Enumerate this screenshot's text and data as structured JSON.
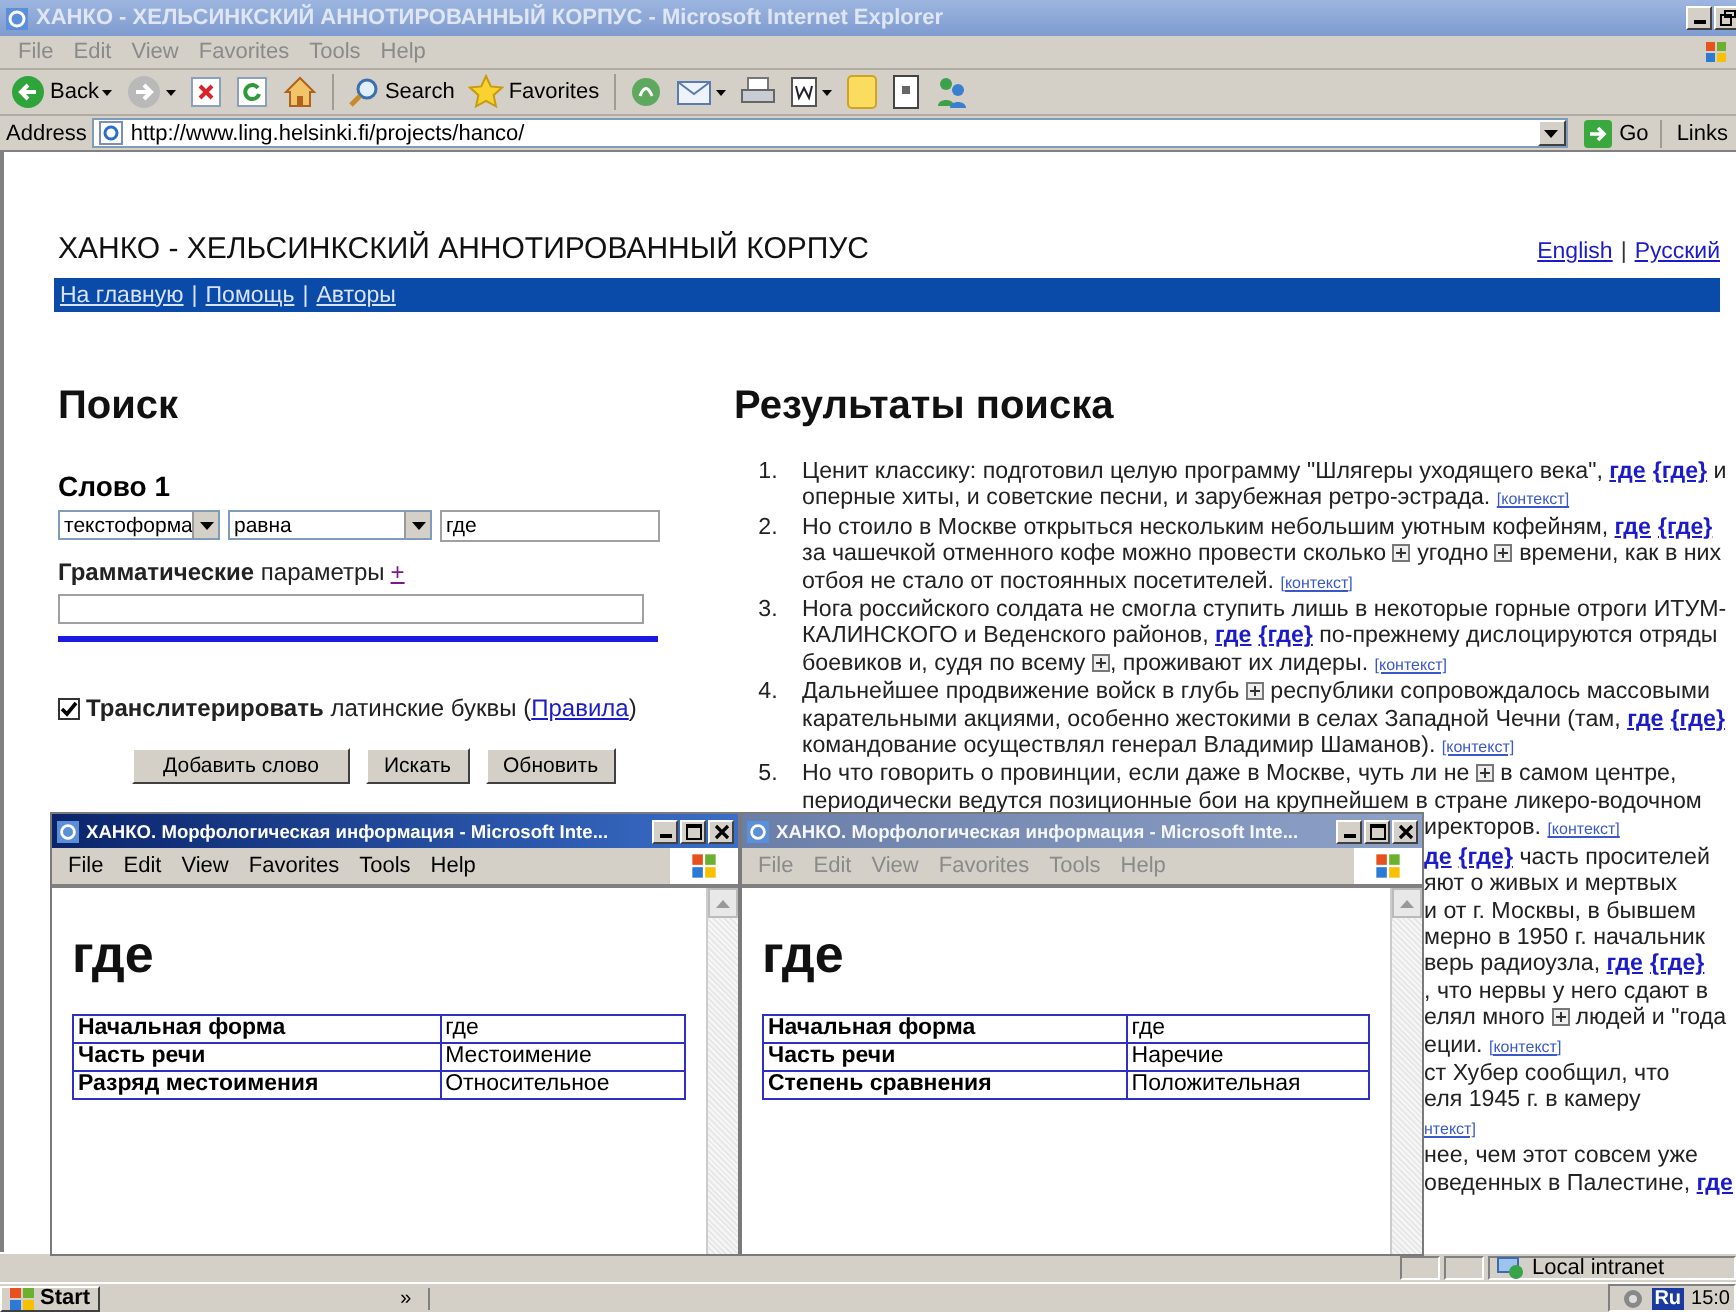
{
  "main_window": {
    "title": "ХАНКО - ХЕЛЬСИНКСКИЙ АННОТИРОВАННЫЙ КОРПУС - Microsoft Internet Explorer",
    "active": false,
    "menu": [
      "File",
      "Edit",
      "View",
      "Favorites",
      "Tools",
      "Help"
    ],
    "toolbar": [
      {
        "kind": "back",
        "label": "Back",
        "dropdown": true
      },
      {
        "kind": "forward",
        "dropdown": true
      },
      {
        "kind": "stop"
      },
      {
        "kind": "refresh"
      },
      {
        "kind": "home"
      },
      {
        "kind": "search",
        "label": "Search"
      },
      {
        "kind": "favorites",
        "label": "Favorites"
      },
      {
        "kind": "media"
      },
      {
        "kind": "mail",
        "dropdown": true
      },
      {
        "kind": "print"
      },
      {
        "kind": "word",
        "dropdown": true
      },
      {
        "kind": "folder"
      },
      {
        "kind": "notes"
      },
      {
        "kind": "messenger"
      }
    ],
    "address": {
      "label": "Address",
      "url": "http://www.ling.helsinki.fi/projects/hanco/",
      "go": "Go",
      "links": "Links"
    }
  },
  "page": {
    "site_title": "ХАНКО - ХЕЛЬСИНКСКИЙ АННОТИРОВАННЫЙ КОРПУС",
    "languages": [
      "English",
      "Русский"
    ],
    "separator": "|",
    "nav": [
      "На главную",
      "Помощь",
      "Авторы"
    ],
    "search": {
      "heading": "Поиск",
      "word_label": "Слово 1",
      "field_type": "текстоформа",
      "relation": "равна",
      "word": "где",
      "grammar_label": "**Грамматические** параметры",
      "grammar_add": "+",
      "transliterate": {
        "checked": true,
        "label": "**Транслитерировать** латинские буквы (",
        "link": "Правила",
        "end": ")"
      },
      "buttons": [
        "Добавить слово",
        "Искать",
        "Обновить"
      ]
    },
    "results": {
      "heading": "Результаты поиска",
      "items": [
        {
          "number": "1.",
          "segments": [
            {
              "kind": "text",
              "text": "Ценит классику: подготовил целую программу \"Шлягеры уходящего века\", "
            },
            {
              "kind": "hit",
              "text": "где"
            },
            {
              "kind": "hit",
              "text": "{где}"
            },
            {
              "kind": "text",
              "text": " и оперные хиты, и советские песни, и зарубежная ретро-эстрада. "
            },
            {
              "kind": "ctx",
              "text": "[контекст]"
            }
          ]
        },
        {
          "number": "2.",
          "segments": [
            {
              "kind": "text",
              "text": "Но стоило в Москве открыться нескольким небольшим уютным кофейням, "
            },
            {
              "kind": "hit",
              "text": "где"
            },
            {
              "kind": "hit",
              "text": "{где}"
            },
            {
              "kind": "text",
              "text": " за чашечкой отменного кофе можно провести сколько "
            },
            {
              "kind": "plus"
            },
            {
              "kind": "text",
              "text": " угодно "
            },
            {
              "kind": "plus"
            },
            {
              "kind": "text",
              "text": " времени, как в них отбоя не стало от постоянных посетителей. "
            },
            {
              "kind": "ctx",
              "text": "[контекст]"
            }
          ]
        },
        {
          "number": "3.",
          "segments": [
            {
              "kind": "text",
              "text": "Нога российского солдата не смогла ступить лишь в некоторые горные отроги ИТУМ-КАЛИНСКОГО и Веденского районов, "
            },
            {
              "kind": "hit",
              "text": "где"
            },
            {
              "kind": "hit",
              "text": "{где}"
            },
            {
              "kind": "text",
              "text": " по-прежнему дислоцируются отряды боевиков и, судя по всему "
            },
            {
              "kind": "plus"
            },
            {
              "kind": "text",
              "text": ", проживают их лидеры. "
            },
            {
              "kind": "ctx",
              "text": "[контекст]"
            }
          ]
        },
        {
          "number": "4.",
          "segments": [
            {
              "kind": "text",
              "text": "Дальнейшее продвижение войск в глубь "
            },
            {
              "kind": "plus"
            },
            {
              "kind": "text",
              "text": " республики сопровождалось массовыми карательными акциями, особенно жестокими в селах Западной Чечни (там, "
            },
            {
              "kind": "hit",
              "text": "где"
            },
            {
              "kind": "hit",
              "text": "{где}"
            },
            {
              "kind": "text",
              "text": " командование осуществлял генерал Владимир Шаманов). "
            },
            {
              "kind": "ctx",
              "text": "[контекст]"
            }
          ]
        },
        {
          "number": "5.",
          "segments": [
            {
              "kind": "text",
              "text": "Но что говорить о провинции, если даже в Москве, чуть ли не "
            },
            {
              "kind": "plus"
            },
            {
              "kind": "text",
              "text": " в самом центре, периодически ведутся позиционные бои на крупнейшем в стране ликеро-водочном"
            }
          ]
        }
      ],
      "fragments": [
        [
          {
            "kind": "text",
            "text": "иректоров. "
          },
          {
            "kind": "ctx",
            "text": "[контекст]"
          }
        ],
        [
          {
            "kind": "hit",
            "text": "де"
          },
          {
            "kind": "hit",
            "text": "{где}"
          },
          {
            "kind": "text",
            "text": " часть просителей"
          }
        ],
        [
          {
            "kind": "text",
            "text": "яют о живых и мертвых"
          }
        ],
        [
          {
            "kind": "text",
            "text": "и от г. Москвы, в бывшем"
          }
        ],
        [
          {
            "kind": "text",
            "text": "мерно в 1950 г. начальник"
          }
        ],
        [
          {
            "kind": "text",
            "text": "верь радиоузла, "
          },
          {
            "kind": "hit",
            "text": "где"
          },
          {
            "kind": "hit",
            "text": "{где}"
          }
        ],
        [
          {
            "kind": "text",
            "text": ", что нервы у него сдают в"
          }
        ],
        [
          {
            "kind": "text",
            "text": "елял много "
          },
          {
            "kind": "plus"
          },
          {
            "kind": "text",
            "text": " людей и \"года"
          }
        ],
        [
          {
            "kind": "text",
            "text": "еции. "
          },
          {
            "kind": "ctx",
            "text": "[контекст]"
          }
        ],
        [
          {
            "kind": "text",
            "text": "ст Хубер сообщил, что"
          }
        ],
        [
          {
            "kind": "text",
            "text": "еля 1945 г. в камеру"
          }
        ],
        [
          {
            "kind": "ctx",
            "text": "нтекст]"
          }
        ],
        [
          {
            "kind": "text",
            "text": "нее, чем этот совсем уже"
          }
        ],
        [
          {
            "kind": "text",
            "text": "оведенных в Палестине, "
          },
          {
            "kind": "hit",
            "text": "где"
          }
        ]
      ]
    }
  },
  "status_bar": {
    "zone": "Local intranet"
  },
  "taskbar": {
    "start": "Start",
    "overflow": "»",
    "language": "Ru",
    "clock": "15:0"
  },
  "popups": [
    {
      "title": "ХАНКО. Морфологическая информация - Microsoft Inte...",
      "active": true,
      "menu": [
        "File",
        "Edit",
        "View",
        "Favorites",
        "Tools",
        "Help"
      ],
      "heading": "где",
      "rows": [
        {
          "label": "Начальная форма",
          "value": "где"
        },
        {
          "label": "Часть речи",
          "value": "Местоимение"
        },
        {
          "label": "Разряд местоимения",
          "value": "Относительное"
        }
      ]
    },
    {
      "title": "ХАНКО. Морфологическая информация - Microsoft Inte...",
      "active": false,
      "menu": [
        "File",
        "Edit",
        "View",
        "Favorites",
        "Tools",
        "Help"
      ],
      "heading": "где",
      "rows": [
        {
          "label": "Начальная форма",
          "value": "где"
        },
        {
          "label": "Часть речи",
          "value": "Наречие"
        },
        {
          "label": "Степень сравнения",
          "value": "Положительная"
        }
      ]
    }
  ]
}
